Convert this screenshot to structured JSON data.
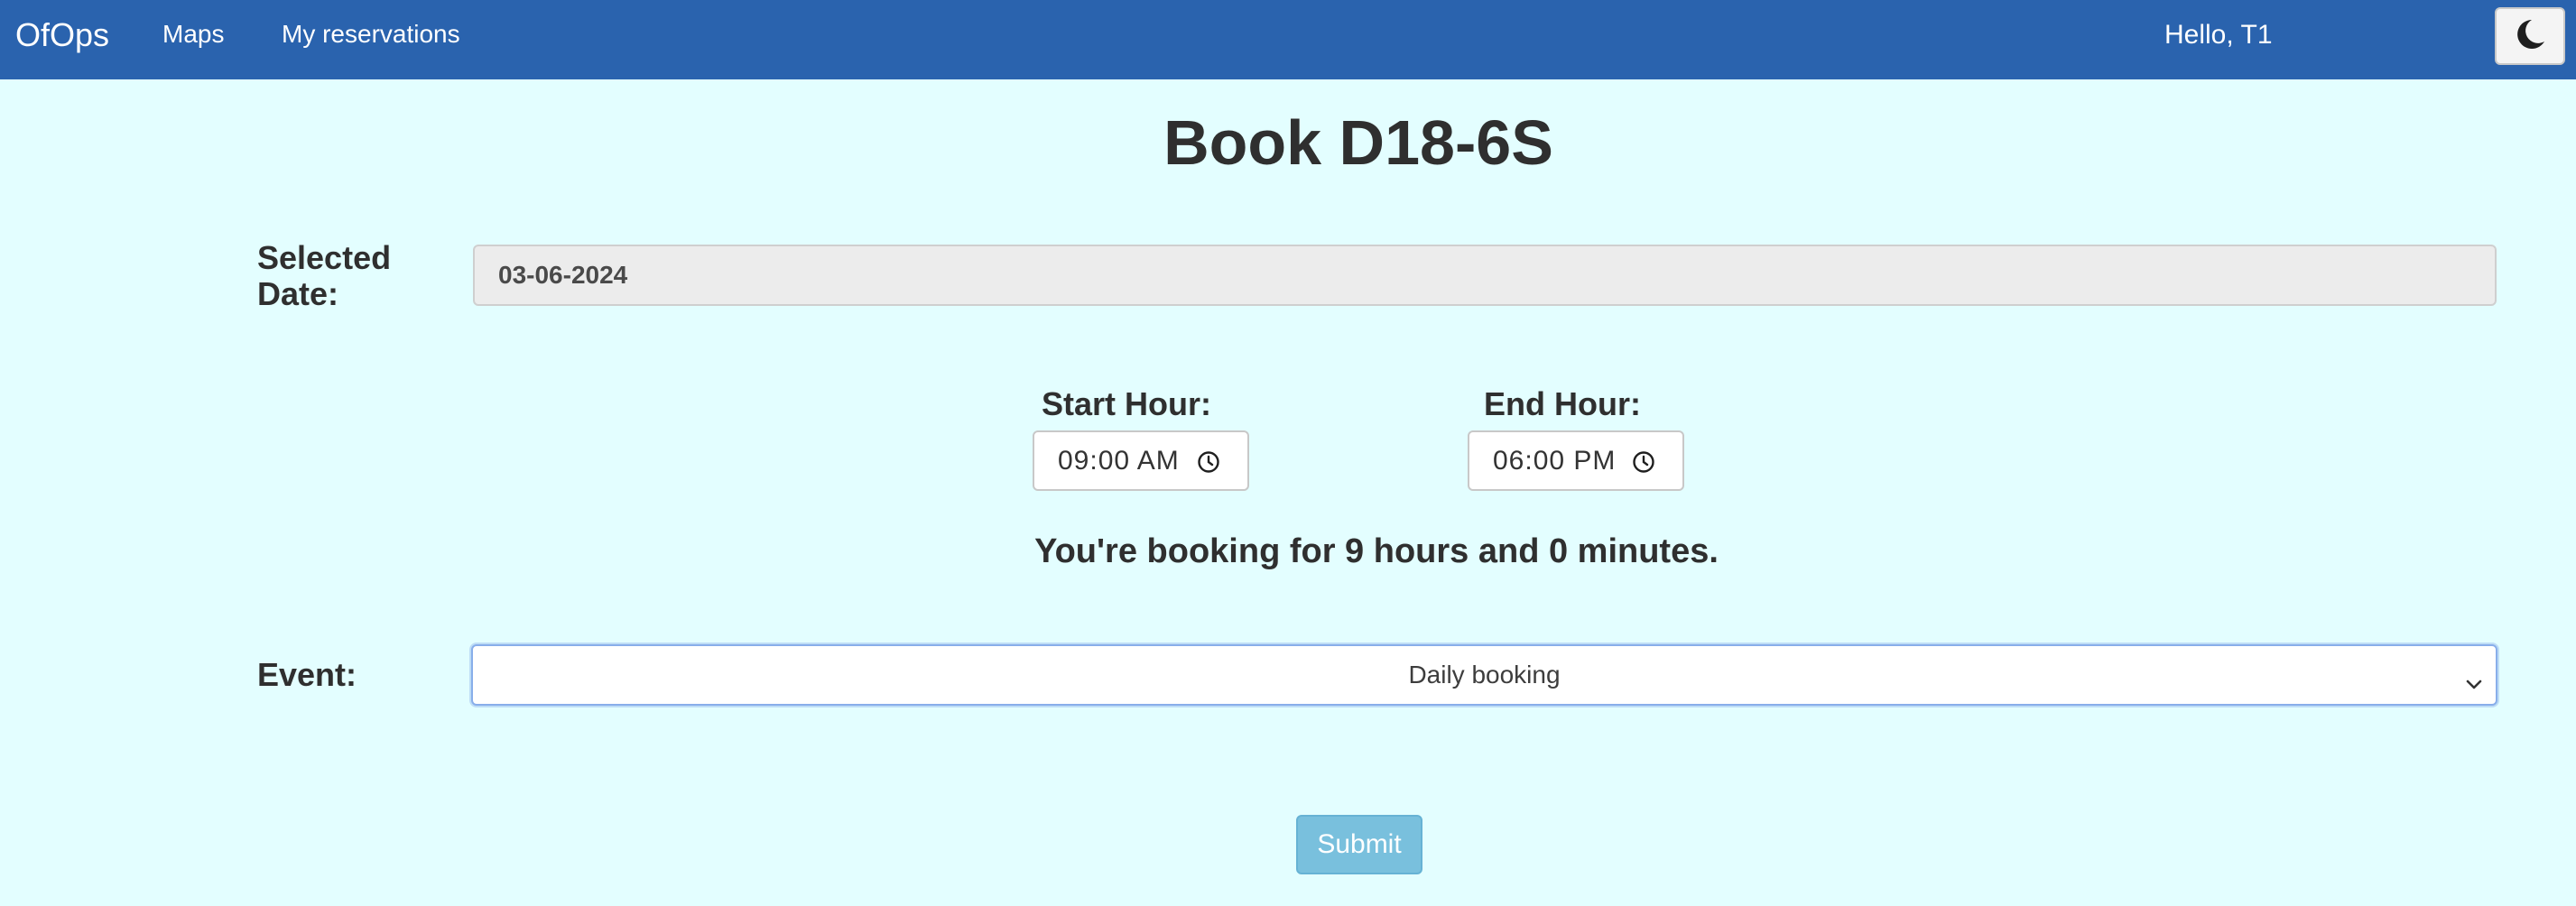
{
  "navbar": {
    "brand": "OfOps",
    "links": [
      "Maps",
      "My reservations"
    ],
    "greeting": "Hello, T1",
    "theme_toggle_icon": "moon-icon"
  },
  "page": {
    "title": "Book D18-6S"
  },
  "form": {
    "selected_date_label": "Selected Date:",
    "selected_date_value": "03-06-2024",
    "start_hour_label": "Start Hour:",
    "start_hour_value": "09:00 AM",
    "end_hour_label": "End Hour:",
    "end_hour_value": "06:00 PM",
    "duration_text": "You're booking for 9 hours and 0 minutes.",
    "event_label": "Event:",
    "event_selected": "Daily booking",
    "submit_label": "Submit"
  },
  "colors": {
    "navbar": "#2a63ae",
    "background": "#e3feff",
    "submit": "#79c0dd"
  }
}
